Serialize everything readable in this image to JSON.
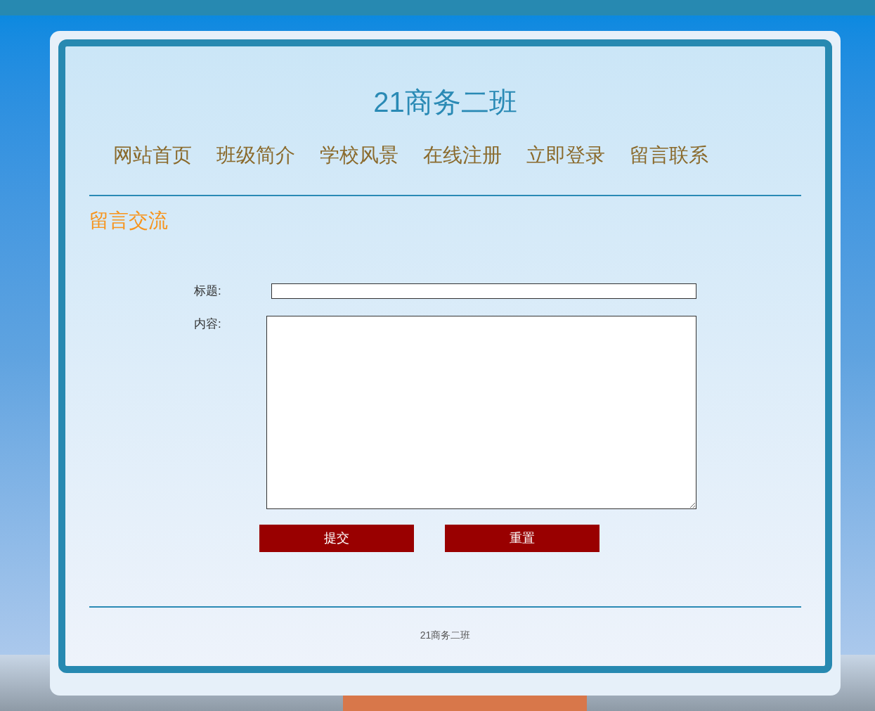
{
  "site_title": "21商务二班",
  "nav": [
    {
      "label": "网站首页"
    },
    {
      "label": "班级简介"
    },
    {
      "label": "学校风景"
    },
    {
      "label": "在线注册"
    },
    {
      "label": "立即登录"
    },
    {
      "label": "留言联系"
    }
  ],
  "section_heading": "留言交流",
  "form": {
    "fields": [
      {
        "kind": "text",
        "label": "标题:"
      },
      {
        "kind": "textarea",
        "label": "内容:"
      }
    ],
    "buttons": [
      {
        "label": "提交"
      },
      {
        "label": "重置"
      }
    ]
  },
  "footer": "21商务二班"
}
